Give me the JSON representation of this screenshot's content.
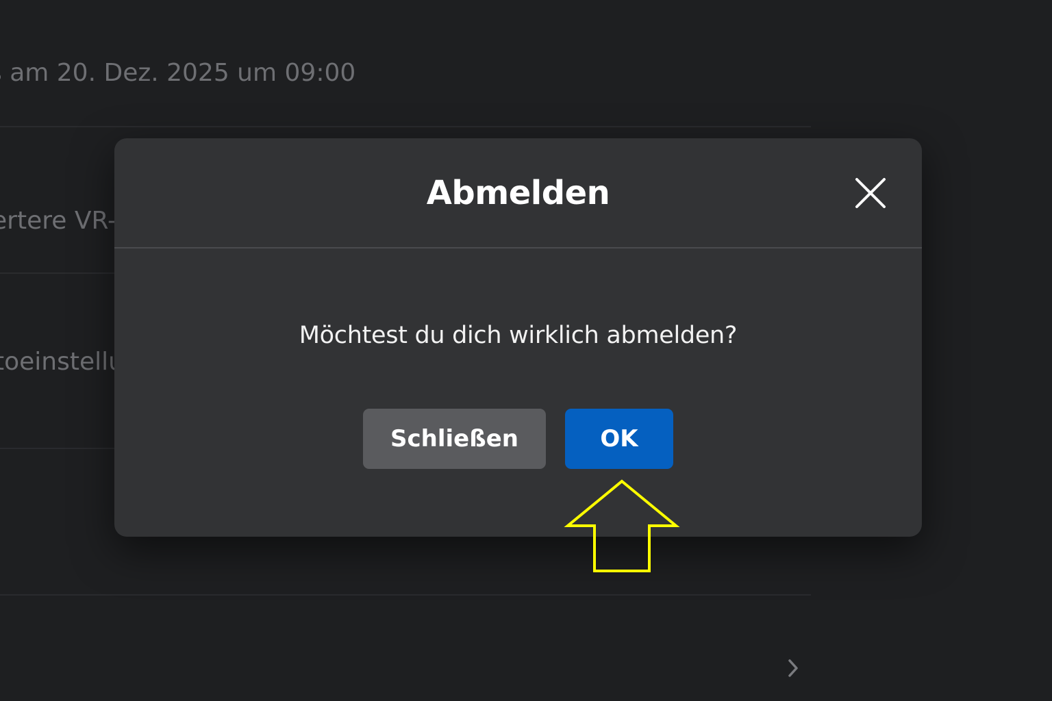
{
  "background": {
    "rows": [
      "s am 20. Dez. 2025 um 09:00",
      "ertere VR-E",
      "toeinstellu"
    ]
  },
  "dialog": {
    "title": "Abmelden",
    "message": "Möchtest du dich wirklich abmelden?",
    "close_label": "Schließen",
    "ok_label": "OK"
  },
  "colors": {
    "page_background": "#1e1f21",
    "dialog_background": "#323335",
    "ok_button": "#0560c0",
    "close_button": "#5a5b5e",
    "annotation_arrow": "#ffff00"
  },
  "icons": {
    "close": "close-icon",
    "chevron": "chevron-right-icon",
    "annotation": "up-arrow-annotation"
  }
}
